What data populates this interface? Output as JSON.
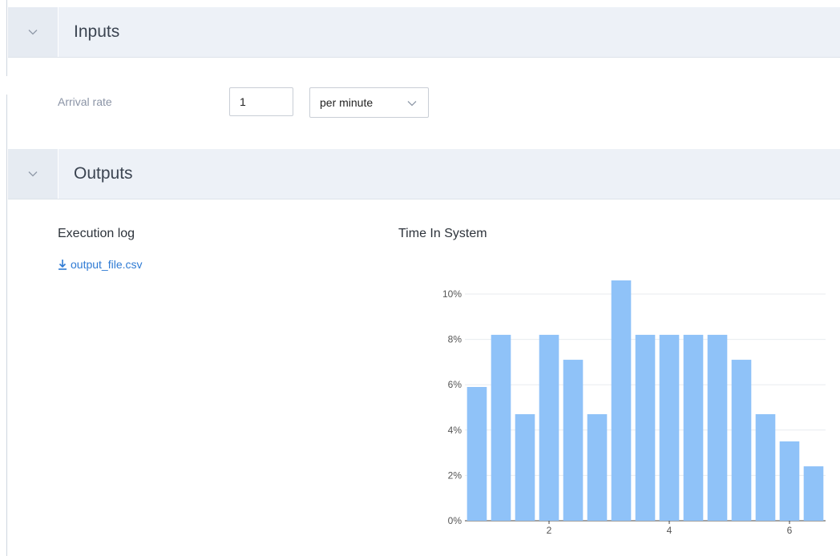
{
  "inputs_section": {
    "title": "Inputs",
    "chevron_icon": "chevron-down-icon"
  },
  "arrival_rate": {
    "label": "Arrival rate",
    "value": "1",
    "unit_selected": "per minute"
  },
  "outputs_section": {
    "title": "Outputs",
    "chevron_icon": "chevron-down-icon"
  },
  "execution_log": {
    "title": "Execution log",
    "download_icon": "download-icon",
    "file_name": "output_file.csv"
  },
  "time_in_system": {
    "title": "Time In System"
  },
  "colors": {
    "bar": "#8fc2f8",
    "link": "#2f7bd4",
    "header_bg": "#edf1f7"
  },
  "chart_data": {
    "type": "bar",
    "x": [
      0.8,
      1.2,
      1.6,
      2.0,
      2.4,
      2.8,
      3.2,
      3.6,
      4.0,
      4.4,
      4.8,
      5.2,
      5.6,
      6.0,
      6.4
    ],
    "values": [
      5.9,
      8.2,
      4.7,
      8.2,
      7.1,
      4.7,
      10.6,
      8.2,
      8.2,
      8.2,
      8.2,
      7.1,
      4.7,
      3.5,
      2.4
    ],
    "xticks": [
      "2",
      "4",
      "6"
    ],
    "xtick_values": [
      2,
      4,
      6
    ],
    "yticks": [
      "0%",
      "2%",
      "4%",
      "6%",
      "8%",
      "10%"
    ],
    "ytick_values": [
      0,
      2,
      4,
      6,
      8,
      10
    ],
    "xlim": [
      0.6,
      6.6
    ],
    "ylim": [
      0,
      10.6
    ],
    "grid": true
  }
}
